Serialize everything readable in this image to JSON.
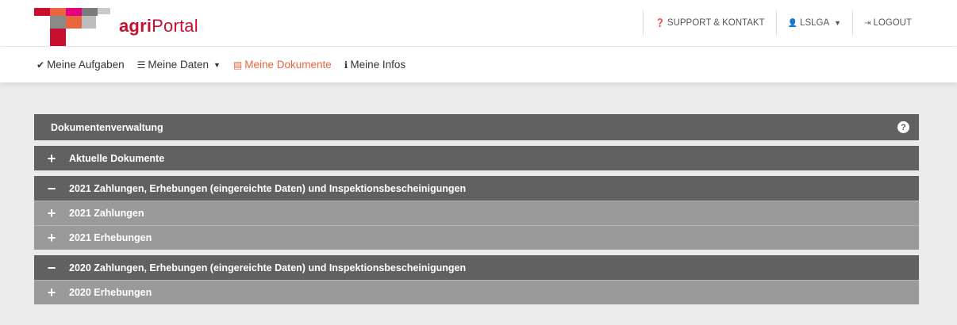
{
  "brand": {
    "part1": "agri",
    "part2": "Portal"
  },
  "top_links": {
    "support": "SUPPORT & KONTAKT",
    "user": "LSLGA",
    "logout": "LOGOUT"
  },
  "nav": {
    "tasks": "Meine Aufgaben",
    "data": "Meine Daten",
    "documents": "Meine Dokumente",
    "infos": "Meine Infos"
  },
  "panel": {
    "title": "Dokumentenverwaltung",
    "help_symbol": "?"
  },
  "sections": {
    "current": {
      "sign": "+",
      "label": "Aktuelle Dokumente"
    },
    "y2021": {
      "sign": "−",
      "label": "2021 Zahlungen, Erhebungen (eingereichte Daten) und Inspektionsbescheinigungen",
      "sub1": {
        "sign": "+",
        "label": "2021 Zahlungen"
      },
      "sub2": {
        "sign": "+",
        "label": "2021 Erhebungen"
      }
    },
    "y2020": {
      "sign": "−",
      "label": "2020 Zahlungen, Erhebungen (eingereichte Daten) und Inspektionsbescheinigungen",
      "sub1": {
        "sign": "+",
        "label": "2020 Erhebungen"
      }
    }
  },
  "colors": {
    "brand_red": "#c8102e",
    "active_nav": "#e8663d",
    "header_dark": "#616161",
    "sub_light": "#9a9a9a"
  }
}
